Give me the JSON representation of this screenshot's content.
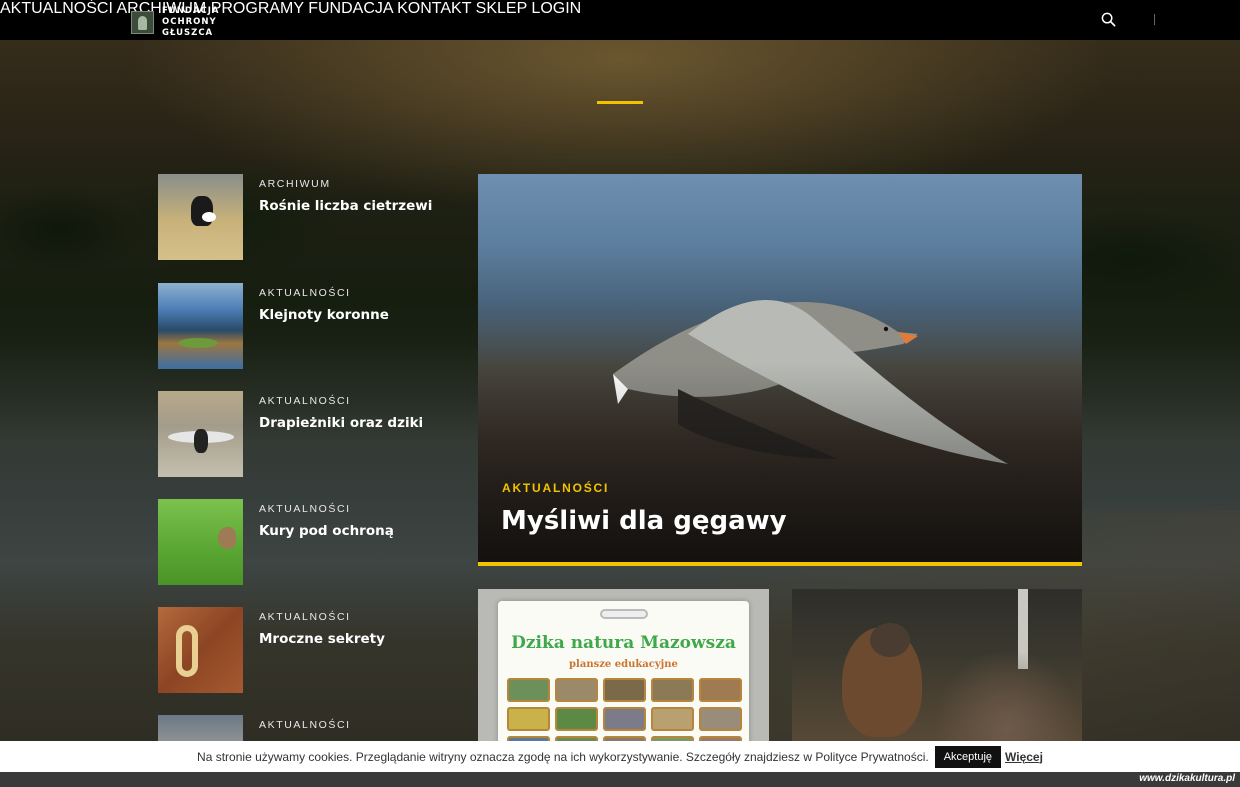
{
  "logo": {
    "line1": "FUNDACJA",
    "line2": "OCHRONY",
    "line3": "GŁUSZCA"
  },
  "nav": {
    "items": [
      "AKTUALNOŚCI",
      "ARCHIWUM",
      "PROGRAMY",
      "FUNDACJA",
      "KONTAKT",
      "SKLEP"
    ],
    "login": "LOGIN",
    "search_icon": "search-icon"
  },
  "colors": {
    "accent": "#f2c300",
    "topbar": "#000000"
  },
  "side_posts": [
    {
      "category": "ARCHIWUM",
      "title": "Rośnie liczba cietrzewi"
    },
    {
      "category": "AKTUALNOŚCI",
      "title": "Klejnoty koronne"
    },
    {
      "category": "AKTUALNOŚCI",
      "title": "Drapieżniki oraz dziki"
    },
    {
      "category": "AKTUALNOŚCI",
      "title": "Kury pod ochroną"
    },
    {
      "category": "AKTUALNOŚCI",
      "title": "Mroczne sekrety"
    },
    {
      "category": "AKTUALNOŚCI",
      "title": ""
    }
  ],
  "featured": {
    "category": "AKTUALNOŚCI",
    "title": "Myśliwi dla gęgawy"
  },
  "cards": [
    {
      "poster_title": "Dzika natura Mazowsza",
      "poster_subtitle": "plansze edukacyjne"
    },
    {}
  ],
  "cookie": {
    "text": "Na stronie używamy cookies. Przeglądanie witryny oznacza zgodę na ich wykorzystywanie. Szczegóły znajdziesz w Polityce Prywatności.",
    "accept": "Akceptuję",
    "more": "Więcej"
  },
  "watermark": "www.dzikakultura.pl"
}
